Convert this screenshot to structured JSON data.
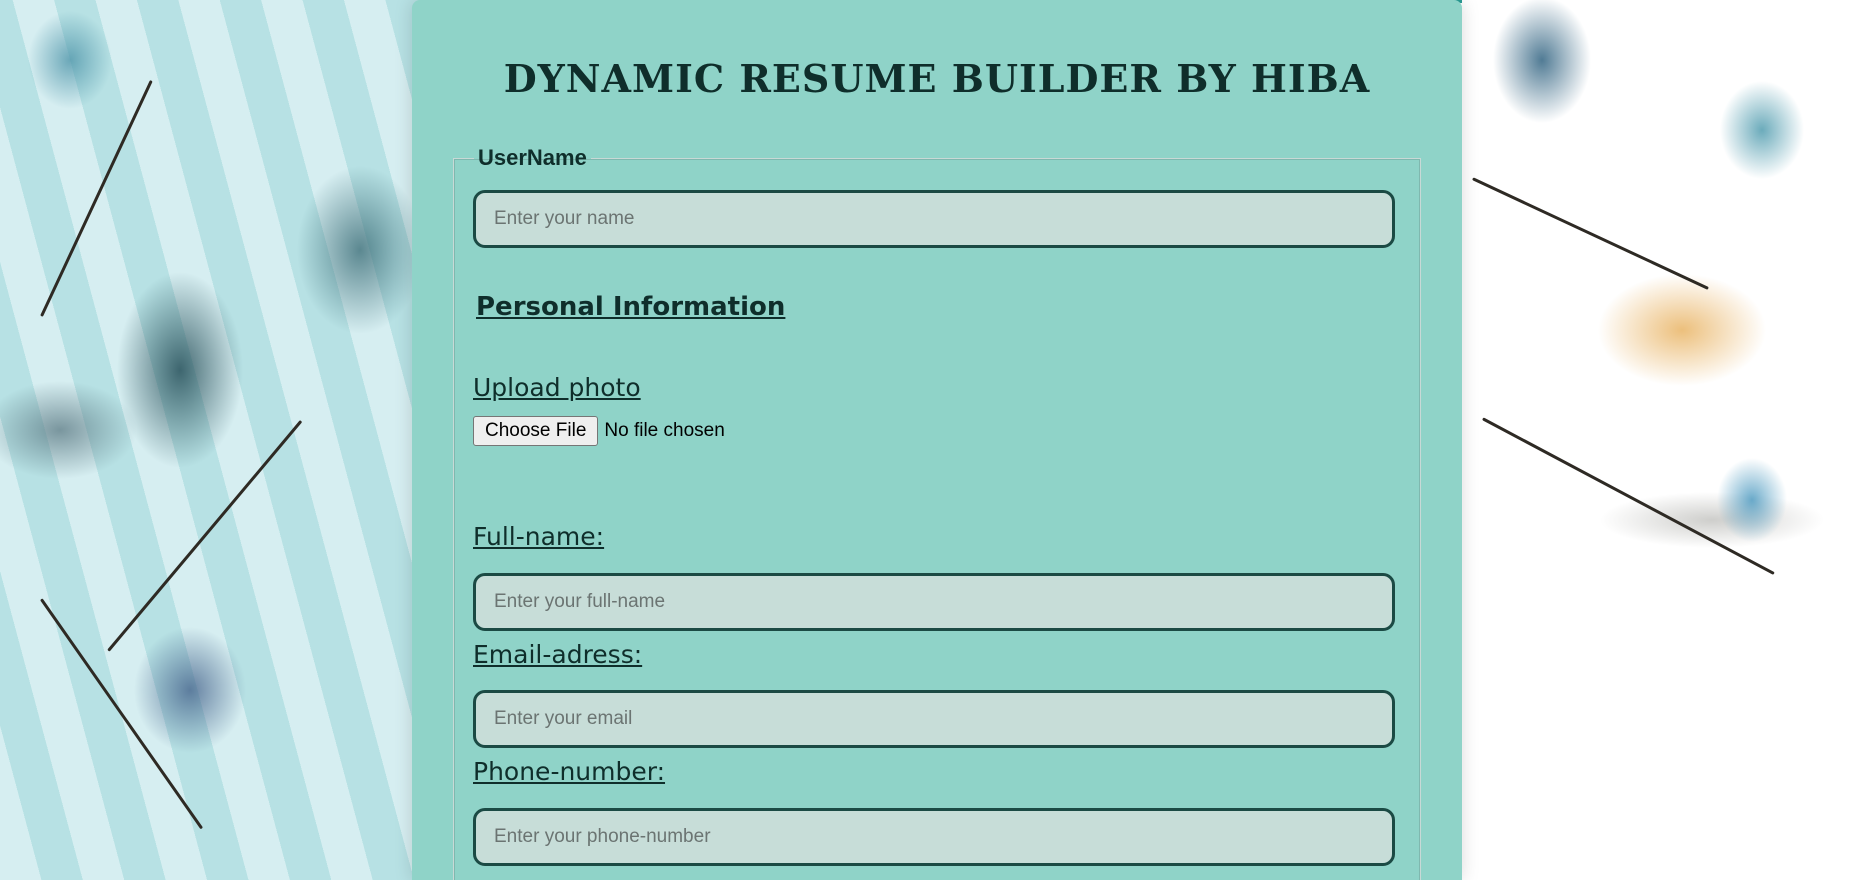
{
  "page": {
    "title": "DYNAMIC RESUME BUILDER BY HIBA"
  },
  "username": {
    "legend": "UserName",
    "placeholder": "Enter your name",
    "value": ""
  },
  "personal_information": {
    "heading": "Personal Information",
    "upload": {
      "label": "Upload photo",
      "button_label": "Choose File",
      "status": "No file chosen"
    },
    "full_name": {
      "label": "Full-name:",
      "placeholder": "Enter your full-name",
      "value": ""
    },
    "email": {
      "label": "Email-adress:",
      "placeholder": "Enter your email",
      "value": ""
    },
    "phone": {
      "label": "Phone-number:",
      "placeholder": "Enter your phone-number",
      "value": ""
    }
  },
  "colors": {
    "panel_background": "#8fd3c8",
    "input_background": "#c7ddd8",
    "input_border": "#1b4a44",
    "text_dark": "#0f2e2b",
    "accent_topline": "#2a9d96"
  }
}
